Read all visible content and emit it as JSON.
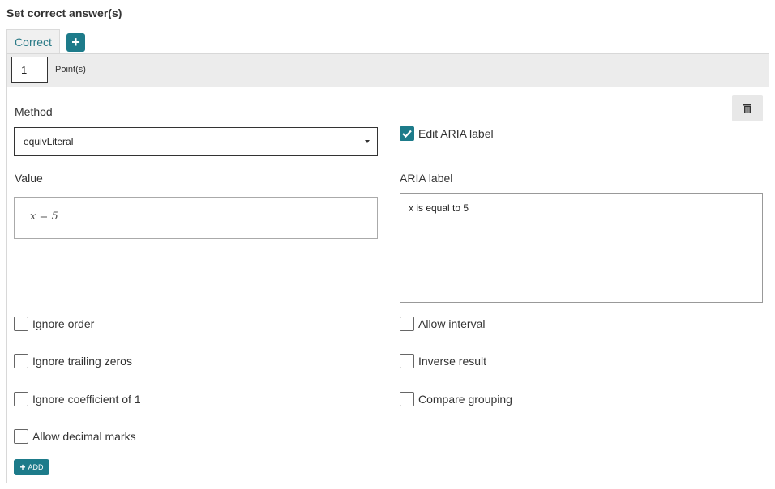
{
  "header": {
    "title": "Set correct answer(s)"
  },
  "tabs": {
    "correct_label": "Correct",
    "add_glyph": "+"
  },
  "points": {
    "value": "1",
    "label": "Point(s)"
  },
  "method": {
    "label": "Method",
    "selected": "equivLiteral"
  },
  "value": {
    "label": "Value",
    "expression": "x = 5"
  },
  "aria": {
    "edit_label": "Edit ARIA label",
    "edit_checked": true,
    "field_label": "ARIA label",
    "text": "x is equal to 5"
  },
  "options_left": [
    {
      "label": "Ignore order",
      "checked": false
    },
    {
      "label": "Ignore trailing zeros",
      "checked": false
    },
    {
      "label": "Ignore coefficient of 1",
      "checked": false
    },
    {
      "label": "Allow decimal marks",
      "checked": false
    }
  ],
  "options_right": [
    {
      "label": "Allow interval",
      "checked": false
    },
    {
      "label": "Inverse result",
      "checked": false
    },
    {
      "label": "Compare grouping",
      "checked": false
    }
  ],
  "add_button": {
    "label": "ADD",
    "glyph": "+"
  },
  "colors": {
    "accent": "#1d7b8a",
    "tab_text": "#2a7a87",
    "bar_bg": "#ececec"
  },
  "icons": {
    "trash": "trash-icon",
    "check": "checkmark-icon",
    "caret": "chevron-down-icon"
  }
}
